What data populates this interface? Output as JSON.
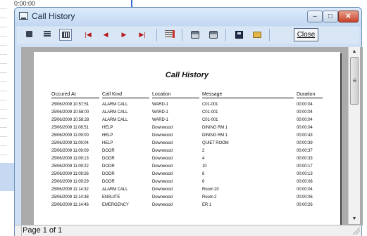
{
  "background": {
    "cell_text": "0:00:00"
  },
  "window": {
    "title": "Call History",
    "controls": {
      "minimize": "–",
      "maximize": "□",
      "close": "✕"
    }
  },
  "toolbar": {
    "close_label": "Close",
    "nav_first": "|◀",
    "nav_prev": "◀",
    "nav_next": "▶",
    "nav_last": "▶|"
  },
  "report": {
    "title": "Call History",
    "columns": [
      "Occured At",
      "Call Kind",
      "Location",
      "Message",
      "Duration"
    ],
    "rows": [
      [
        "25/06/2009 10:57:51",
        "ALARM CALL",
        "WARD-1",
        "C01-001",
        "00:00:04"
      ],
      [
        "25/06/2009 10:58:00",
        "ALARM CALL",
        "WARD-1",
        "C01-001",
        "00:00:04"
      ],
      [
        "25/06/2009 10:58:28",
        "ALARM CALL",
        "WARD-1",
        "C01-001",
        "00:00:04"
      ],
      [
        "25/06/2009 11:08:51",
        "HELP",
        "Downwood",
        "DINING RM 1",
        "00:00:04"
      ],
      [
        "25/06/2009 11:09:00",
        "HELP",
        "Downwood",
        "DINING RM 1",
        "00:00:43"
      ],
      [
        "25/06/2009 11:09:04",
        "HELP",
        "Downwood",
        "QUIET ROOM",
        "00:00:39"
      ],
      [
        "25/06/2009 11:09:09",
        "DOOR",
        "Downwood",
        "2",
        "00:00:37"
      ],
      [
        "25/06/2009 11:09:13",
        "DOOR",
        "Downwood",
        "4",
        "00:00:33"
      ],
      [
        "25/06/2009 11:09:22",
        "DOOR",
        "Downwood",
        "10",
        "00:00:17"
      ],
      [
        "25/06/2009 11:09:26",
        "DOOR",
        "Downwood",
        "8",
        "00:00:13"
      ],
      [
        "25/06/2009 11:09:29",
        "DOOR",
        "Downwood",
        "6",
        "00:00:08"
      ],
      [
        "25/06/2009 11:14:32",
        "ALARM CALL",
        "Downwood",
        "Room 20",
        "00:00:04"
      ],
      [
        "25/06/2009 11:14:38",
        "ENSUITE",
        "Downwood",
        "Room 2",
        "00:00:06"
      ],
      [
        "25/06/2009 11:14:46",
        "EMERGENCY",
        "Downwood",
        "ER 1",
        "00:00:26"
      ]
    ]
  },
  "status": {
    "page_text": "Page 1 of 1"
  },
  "scrollbar": {
    "up": "▲",
    "down": "▼"
  }
}
